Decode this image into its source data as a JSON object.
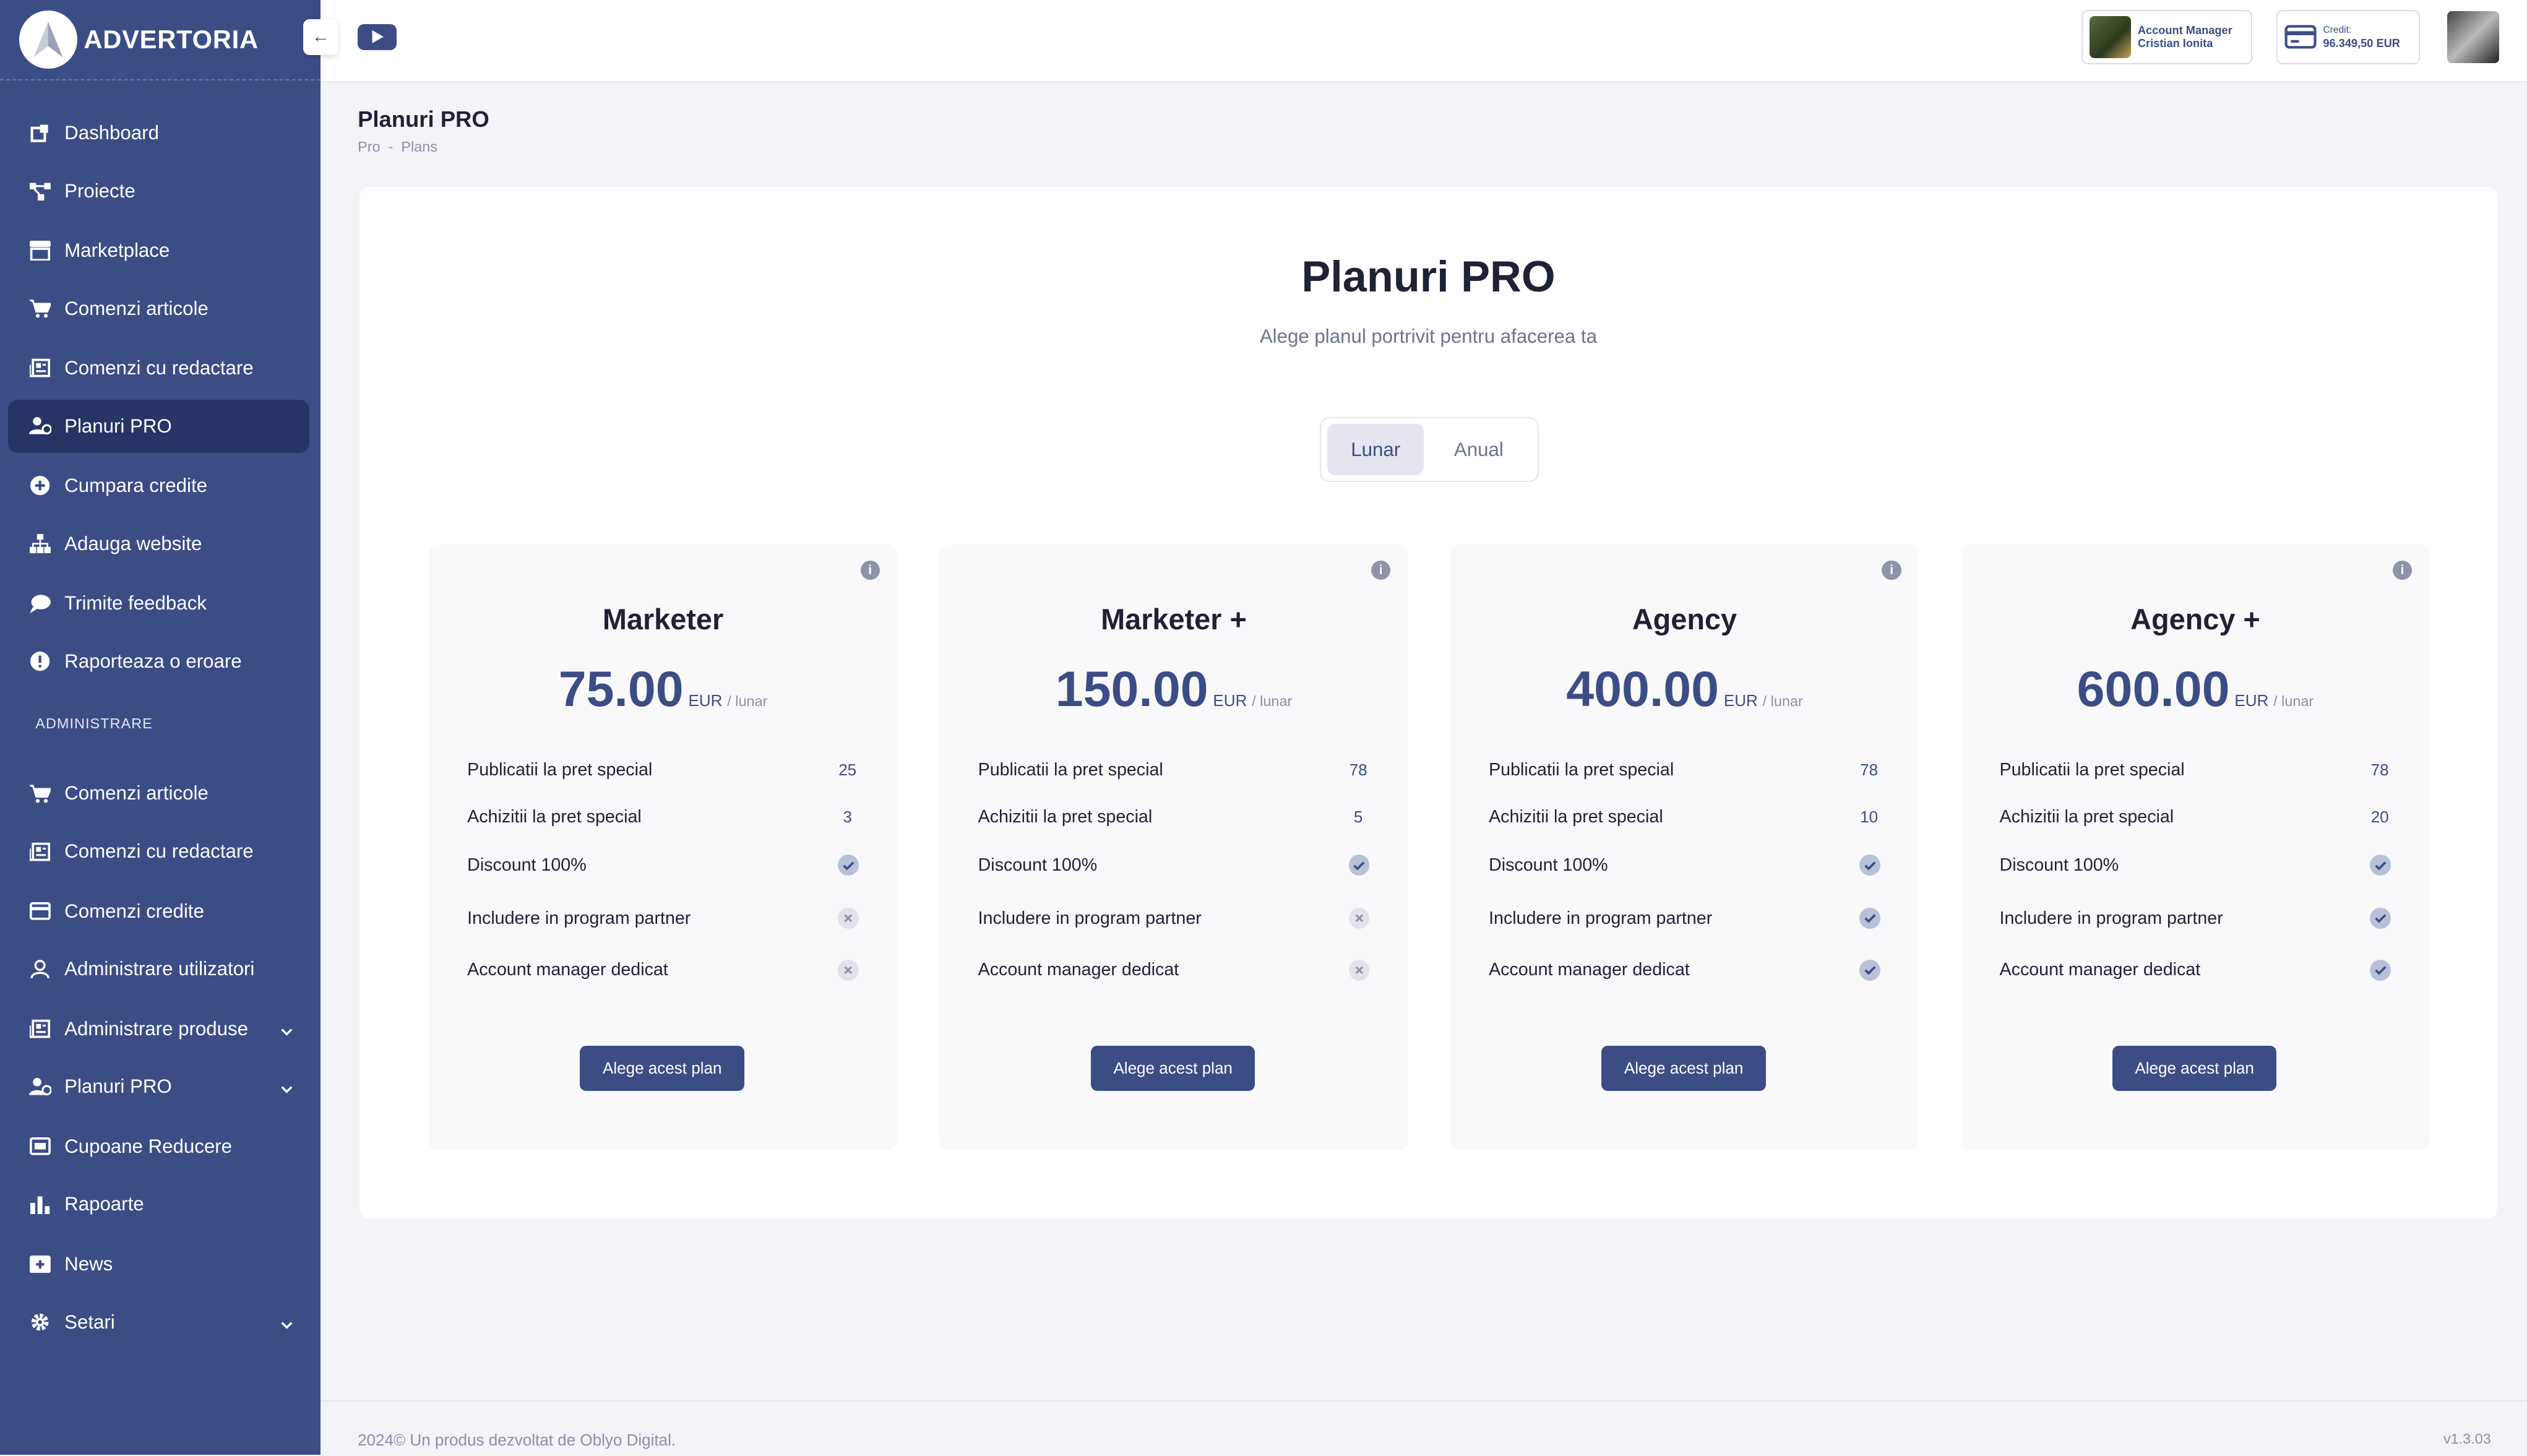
{
  "brand": {
    "name": "ADVERTORIA"
  },
  "sidebar": {
    "items": [
      {
        "label": "Dashboard",
        "icon": "dashboard-icon"
      },
      {
        "label": "Proiecte",
        "icon": "projects-icon"
      },
      {
        "label": "Marketplace",
        "icon": "store-icon"
      },
      {
        "label": "Comenzi articole",
        "icon": "cart-icon"
      },
      {
        "label": "Comenzi cu redactare",
        "icon": "newspaper-icon"
      },
      {
        "label": "Planuri PRO",
        "icon": "user-shield-icon",
        "active": true
      },
      {
        "label": "Cumpara credite",
        "icon": "plus-circle-icon"
      },
      {
        "label": "Adauga website",
        "icon": "sitemap-icon"
      },
      {
        "label": "Trimite feedback",
        "icon": "chat-icon"
      },
      {
        "label": "Raporteaza o eroare",
        "icon": "alert-icon"
      }
    ],
    "admin_section": "ADMINISTRARE",
    "admin_items": [
      {
        "label": "Comenzi articole",
        "icon": "cart-icon"
      },
      {
        "label": "Comenzi cu redactare",
        "icon": "newspaper-icon"
      },
      {
        "label": "Comenzi credite",
        "icon": "card-icon"
      },
      {
        "label": "Administrare utilizatori",
        "icon": "user-icon"
      },
      {
        "label": "Administrare produse",
        "icon": "newspaper-icon",
        "has_submenu": true
      },
      {
        "label": "Planuri PRO",
        "icon": "user-shield-icon",
        "has_submenu": true
      },
      {
        "label": "Cupoane Reducere",
        "icon": "coupon-icon"
      },
      {
        "label": "Rapoarte",
        "icon": "bar-chart-icon"
      },
      {
        "label": "News",
        "icon": "news-icon"
      },
      {
        "label": "Setari",
        "icon": "gear-icon",
        "has_submenu": true
      }
    ]
  },
  "header": {
    "account_manager": {
      "label": "Account Manager",
      "name": "Cristian Ionita"
    },
    "credit": {
      "label": "Credit:",
      "value": "96.349,50 EUR"
    }
  },
  "page": {
    "title": "Planuri PRO",
    "breadcrumb": [
      "Pro",
      "-",
      "Plans"
    ]
  },
  "hero": {
    "title": "Planuri PRO",
    "subtitle": "Alege planul portrivit pentru afacerea ta"
  },
  "billing_toggle": {
    "options": [
      "Lunar",
      "Anual"
    ],
    "selected": "Lunar"
  },
  "plans": [
    {
      "name": "Marketer",
      "price": "75.00",
      "currency": "EUR",
      "period": "/ lunar",
      "features": [
        {
          "label": "Publicatii la pret special",
          "value": "25"
        },
        {
          "label": "Achizitii la pret special",
          "value": "3"
        },
        {
          "label": "Discount 100%",
          "included": true
        },
        {
          "label": "Includere in program partner",
          "included": false
        },
        {
          "label": "Account manager dedicat",
          "included": false
        }
      ],
      "cta": "Alege acest plan"
    },
    {
      "name": "Marketer +",
      "price": "150.00",
      "currency": "EUR",
      "period": "/ lunar",
      "features": [
        {
          "label": "Publicatii la pret special",
          "value": "78"
        },
        {
          "label": "Achizitii la pret special",
          "value": "5"
        },
        {
          "label": "Discount 100%",
          "included": true
        },
        {
          "label": "Includere in program partner",
          "included": false
        },
        {
          "label": "Account manager dedicat",
          "included": false
        }
      ],
      "cta": "Alege acest plan"
    },
    {
      "name": "Agency",
      "price": "400.00",
      "currency": "EUR",
      "period": "/ lunar",
      "features": [
        {
          "label": "Publicatii la pret special",
          "value": "78"
        },
        {
          "label": "Achizitii la pret special",
          "value": "10"
        },
        {
          "label": "Discount 100%",
          "included": true
        },
        {
          "label": "Includere in program partner",
          "included": true
        },
        {
          "label": "Account manager dedicat",
          "included": true
        }
      ],
      "cta": "Alege acest plan"
    },
    {
      "name": "Agency +",
      "price": "600.00",
      "currency": "EUR",
      "period": "/ lunar",
      "features": [
        {
          "label": "Publicatii la pret special",
          "value": "78"
        },
        {
          "label": "Achizitii la pret special",
          "value": "20"
        },
        {
          "label": "Discount 100%",
          "included": true
        },
        {
          "label": "Includere in program partner",
          "included": true
        },
        {
          "label": "Account manager dedicat",
          "included": true
        }
      ],
      "cta": "Alege acest plan"
    }
  ],
  "footer": {
    "copyright": "2024© Un produs dezvoltat de Oblyo Digital.",
    "version": "v1.3.03"
  },
  "colors": {
    "sidebar": "#3c4d86",
    "sidebar_active": "#263566",
    "accent": "#3c4d86",
    "background": "#f3f4f8"
  }
}
